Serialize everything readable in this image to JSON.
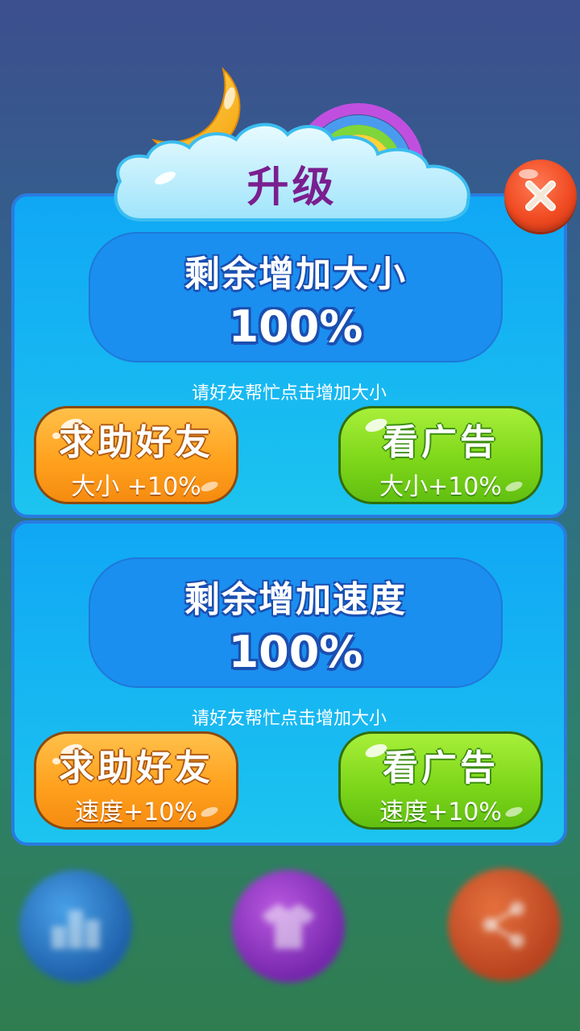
{
  "dialog": {
    "title": "升级",
    "close_icon": "close-icon"
  },
  "size_section": {
    "label": "剩余增加大小",
    "value": "100%",
    "hint": "请好友帮忙点击增加大小",
    "ask_friend_button": {
      "label": "求助好友",
      "sub": "大小 +10%"
    },
    "watch_ad_button": {
      "label": "看广告",
      "sub": "大小+10%"
    }
  },
  "speed_section": {
    "label": "剩余增加速度",
    "value": "100%",
    "hint": "请好友帮忙点击增加大小",
    "ask_friend_button": {
      "label": "求助好友",
      "sub": "速度+10%"
    },
    "watch_ad_button": {
      "label": "看广告",
      "sub": "速度+10%"
    }
  },
  "background_buttons": {
    "left_icon": "rank-icon",
    "center_icon": "shirt-icon",
    "right_icon": "share-icon"
  },
  "colors": {
    "panel": "#10a7f5",
    "title": "#7a1f8f",
    "orange_button": "#ffa21e",
    "green_button": "#7ed71a",
    "close_button": "#f04b22"
  }
}
